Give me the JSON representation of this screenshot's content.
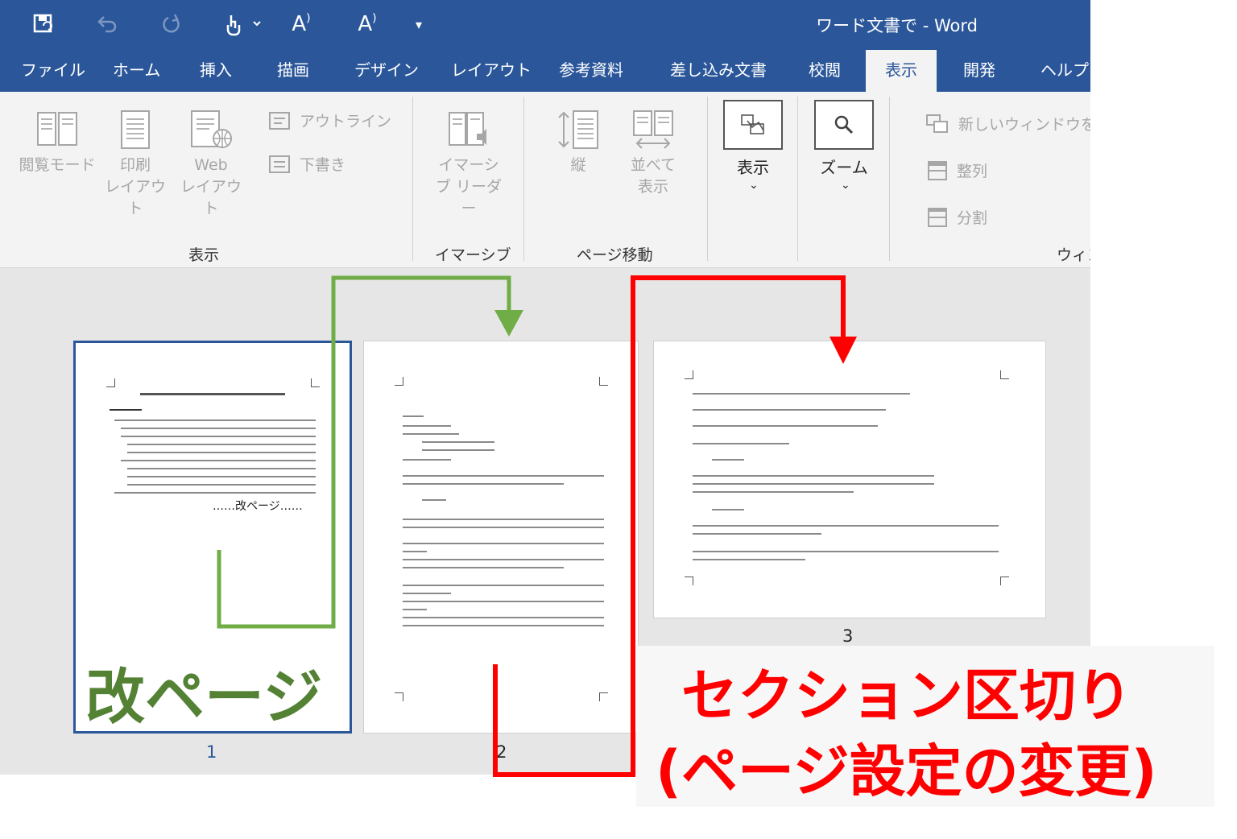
{
  "window_title": "ワード文書で  -  Word",
  "quick_access": {
    "save_icon": "save-icon",
    "undo_icon": "undo-icon",
    "redo_icon": "redo-icon",
    "touch_icon": "touch-mode-icon",
    "font_grow_label": "A",
    "font_shrink_label": "A",
    "customize_icon": "customize-icon"
  },
  "tabs": [
    "ファイル",
    "ホーム",
    "挿入",
    "描画",
    "デザイン",
    "レイアウト",
    "参考資料",
    "差し込み文書",
    "校閲",
    "表示",
    "開発",
    "ヘルプ"
  ],
  "active_tab": "表示",
  "ribbon": {
    "views": {
      "read_mode": "閲覧モード",
      "print_layout_1": "印刷",
      "print_layout_2": "レイアウト",
      "web_layout_1": "Web",
      "web_layout_2": "レイアウト",
      "outline": "アウトライン",
      "draft": "下書き",
      "group": "表示"
    },
    "immersive": {
      "reader_1": "イマーシ",
      "reader_2": "ブ リーダー",
      "group": "イマーシブ"
    },
    "page_movement": {
      "vertical": "縦",
      "side_1": "並べて",
      "side_2": "表示",
      "group": "ページ移動"
    },
    "show": {
      "label": "表示"
    },
    "zoom": {
      "label": "ズーム"
    },
    "window": {
      "new_window": "新しいウィンドウを開く",
      "arrange": "整列",
      "split": "分割",
      "group": "ウィン"
    }
  },
  "pages": {
    "p1_num": "1",
    "p2_num": "2",
    "p3_num": "3",
    "page_break_label": "……改ページ……"
  },
  "annotations": {
    "page_break": "改ページ",
    "section_break_1": "セクション区切り",
    "section_break_2": "(ページ設定の変更)"
  },
  "colors": {
    "word_blue": "#2b579a",
    "green_arrow": "#70ad47",
    "green_text": "#548235",
    "red": "#ff0000"
  }
}
